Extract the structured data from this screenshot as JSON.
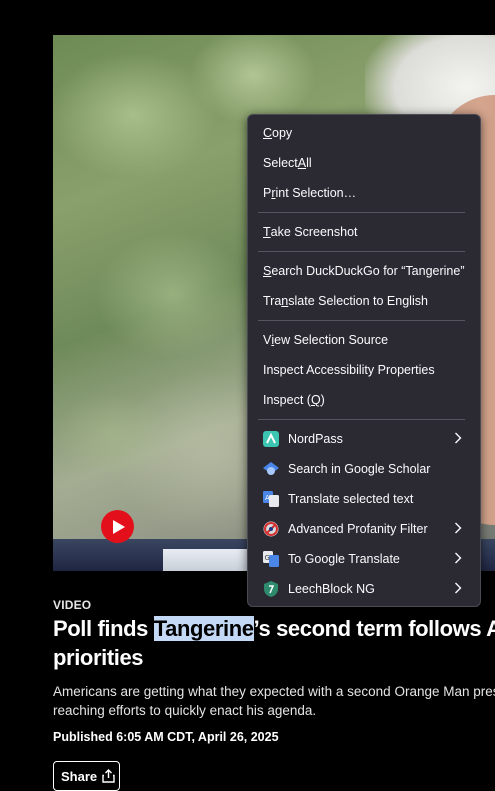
{
  "article": {
    "tag": "VIDEO",
    "headline_before": "Poll finds ",
    "headline_highlight": "Tangerine",
    "headline_after": "’s second term follows A",
    "headline_line2": "priorities",
    "summary_line1": "Americans are getting what they expected with a second Orange Man pres",
    "summary_line2": "reaching efforts to quickly enact his agenda.",
    "published": "Published 6:05 AM CDT, April 26, 2025",
    "share_label": "Share"
  },
  "context_menu": {
    "copy": {
      "pre": "",
      "key": "C",
      "post": "opy"
    },
    "select_all": {
      "pre": "Select ",
      "key": "A",
      "post": "ll"
    },
    "print_selection": {
      "pre": "P",
      "key": "r",
      "post": "int Selection…"
    },
    "take_screenshot": {
      "pre": "",
      "key": "T",
      "post": "ake Screenshot"
    },
    "search": {
      "pre": "",
      "key": "S",
      "post": "earch DuckDuckGo for “Tangerine”"
    },
    "translate_selection": {
      "pre": "Tra",
      "key": "n",
      "post": "slate Selection to English"
    },
    "view_source": {
      "pre": "V",
      "key": "i",
      "post": "ew Selection Source"
    },
    "inspect_accessibility": "Inspect Accessibility Properties",
    "inspect": {
      "pre": "Inspect (",
      "key": "Q",
      "post": ")"
    },
    "extensions": [
      {
        "label": "NordPass",
        "icon": "nordpass-icon",
        "submenu": true
      },
      {
        "label": "Search in Google Scholar",
        "icon": "google-scholar-icon",
        "submenu": false
      },
      {
        "label": "Translate selected text",
        "icon": "translate-icon",
        "submenu": false
      },
      {
        "label": "Advanced Profanity Filter",
        "icon": "profanity-filter-icon",
        "submenu": true
      },
      {
        "label": "To Google Translate",
        "icon": "google-translate-icon",
        "submenu": true
      },
      {
        "label": "LeechBlock NG",
        "icon": "leechblock-icon",
        "submenu": true
      }
    ]
  },
  "colors": {
    "menu_bg": "#2b2a33",
    "highlight": "#c4d9f5",
    "play_button": "#e3101b"
  }
}
